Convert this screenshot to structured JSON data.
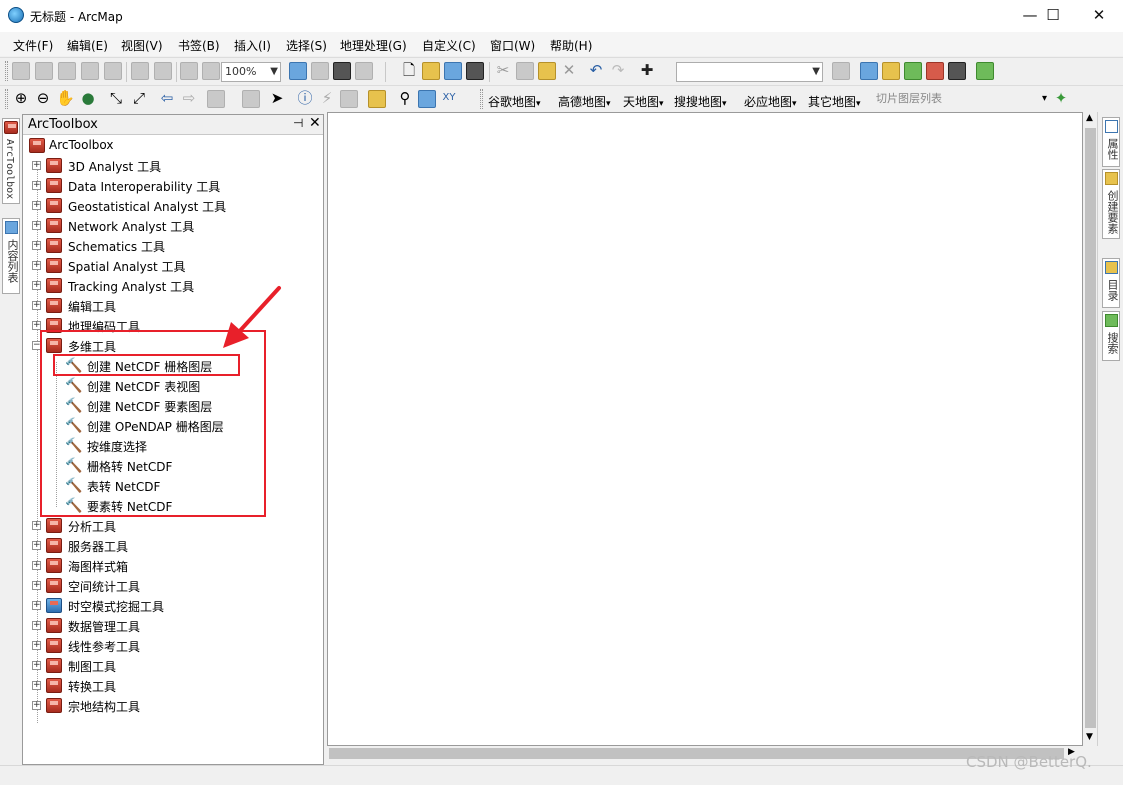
{
  "window": {
    "title": "无标题 - ArcMap",
    "min": "—",
    "max": "☐",
    "close": "✕"
  },
  "menubar": [
    "文件(F)",
    "编辑(E)",
    "视图(V)",
    "书签(B)",
    "插入(I)",
    "选择(S)",
    "地理处理(G)",
    "自定义(C)",
    "窗口(W)",
    "帮助(H)"
  ],
  "toolbar1": {
    "zoom_value": "100%",
    "layer_combo": ""
  },
  "toolbar2": {
    "map_menus": [
      "谷歌地图",
      "高德地图",
      "天地图",
      "搜搜地图",
      "必应地图",
      "其它地图"
    ],
    "tile_layer_placeholder": "切片图层列表"
  },
  "left_dock": {
    "tab1": "ArcToolbox",
    "tab2": "内容列表"
  },
  "right_dock": {
    "tab1": "属性",
    "tab2": "创建要素",
    "tab3": "目录",
    "tab4": "搜索"
  },
  "toolbox": {
    "title": "ArcToolbox",
    "root": "ArcToolbox",
    "items_top": [
      "3D Analyst 工具",
      "Data Interoperability 工具",
      "Geostatistical Analyst 工具",
      "Network Analyst 工具",
      "Schematics 工具",
      "Spatial Analyst 工具",
      "Tracking Analyst 工具",
      "编辑工具",
      "地理编码工具"
    ],
    "expanded": "多维工具",
    "tools": [
      "创建 NetCDF 栅格图层",
      "创建 NetCDF 表视图",
      "创建 NetCDF 要素图层",
      "创建 OPeNDAP 栅格图层",
      "按维度选择",
      "栅格转 NetCDF",
      "表转 NetCDF",
      "要素转 NetCDF"
    ],
    "items_bottom": [
      "分析工具",
      "服务器工具",
      "海图样式箱",
      "空间统计工具",
      "时空模式挖掘工具",
      "数据管理工具",
      "线性参考工具",
      "制图工具",
      "转换工具",
      "宗地结构工具"
    ]
  },
  "annotation_color": "#e8202a",
  "watermark": "CSDN @BetterQ."
}
